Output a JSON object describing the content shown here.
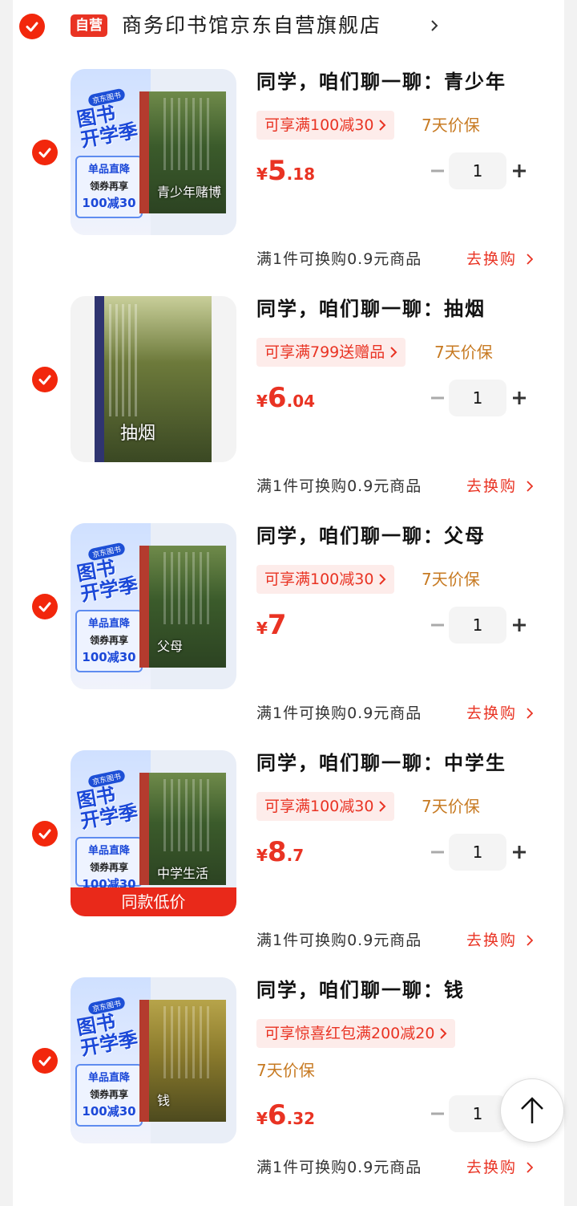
{
  "shop": {
    "badge": "自营",
    "name": "商务印书馆京东自营旗舰店"
  },
  "common": {
    "exchange_text": "满1件可换购0.9元商品",
    "exchange_action": "去换购",
    "protect": "7天价保",
    "currency": "¥",
    "thumb_promo": {
      "badge": "京东图书",
      "big1": "图书",
      "big2": "开学季",
      "line1": "单品直降",
      "line2": "领券再享",
      "line3": "100减30"
    }
  },
  "items": [
    {
      "title": "同学，咱们聊一聊：青少年",
      "promo": "可享满100减30",
      "price_int": "5",
      "price_dec": ".18",
      "qty": "1",
      "cover_text": "青少年赌博"
    },
    {
      "title": "同学，咱们聊一聊：抽烟",
      "promo": "可享满799送赠品",
      "price_int": "6",
      "price_dec": ".04",
      "qty": "1",
      "cover_text": "抽烟"
    },
    {
      "title": "同学，咱们聊一聊：父母",
      "promo": "可享满100减30",
      "price_int": "7",
      "price_dec": "",
      "qty": "1",
      "cover_text": "父母"
    },
    {
      "title": "同学，咱们聊一聊：中学生",
      "promo": "可享满100减30",
      "price_int": "8",
      "price_dec": ".7",
      "qty": "1",
      "cover_text": "中学生活",
      "low_price_label": "同款低价"
    },
    {
      "title": "同学，咱们聊一聊：钱",
      "promo": "可享惊喜红包满200减20",
      "price_int": "6",
      "price_dec": ".32",
      "qty": "1",
      "cover_text": "钱"
    }
  ],
  "colors": {
    "accent": "#e93323",
    "protect": "#c77a22"
  }
}
